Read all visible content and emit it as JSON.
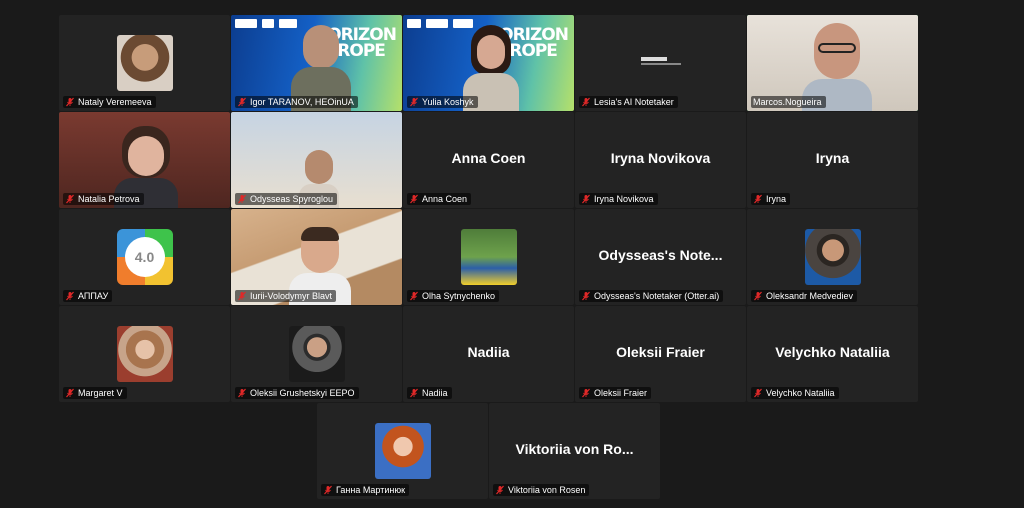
{
  "tiles": [
    {
      "name": "Nataly Veremeeva"
    },
    {
      "name": "Igor TARANOV, HEOinUA",
      "banner": "HORIZON\nEUROPE"
    },
    {
      "name": "Yulia Koshyk",
      "banner": "HORIZON\nEUROPE"
    },
    {
      "name": "Lesia's AI Notetaker"
    },
    {
      "name": "Marcos.Nogueira"
    },
    {
      "name": "Natalia Petrova"
    },
    {
      "name": "Odysseas Spyroglou"
    },
    {
      "name": "Anna Coen",
      "display": "Anna Coen"
    },
    {
      "name": "Iryna Novikova",
      "display": "Iryna Novikova"
    },
    {
      "name": "Iryna",
      "display": "Iryna"
    },
    {
      "name": "АППАУ",
      "badge": "4.0"
    },
    {
      "name": "Iurii-Volodymyr Blavt"
    },
    {
      "name": "Olha Sytnychenko"
    },
    {
      "name": "Odysseas's Notetaker (Otter.ai)",
      "display": "Odysseas's  Note..."
    },
    {
      "name": "Oleksandr Medvediev"
    },
    {
      "name": "Margaret V"
    },
    {
      "name": "Oleksii Grushetskyi EEPO"
    },
    {
      "name": "Nadiia",
      "display": "Nadiia"
    },
    {
      "name": "Oleksii Fraier",
      "display": "Oleksii Fraier"
    },
    {
      "name": "Velychko Nataliia",
      "display": "Velychko Nataliia"
    }
  ],
  "last_row": [
    {
      "name": "Ганна Мартинюк"
    },
    {
      "name": "Viktoriia von Rosen",
      "display": "Viktoriia von Ro..."
    }
  ],
  "colors": {
    "active_speaker_border": "#23d959",
    "tile_bg": "#232323",
    "mic_muted": "#e02828"
  }
}
